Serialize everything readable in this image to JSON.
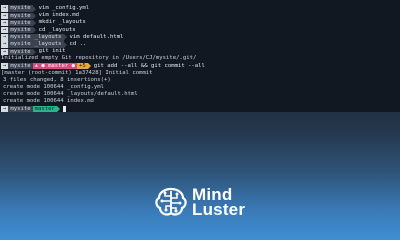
{
  "terminal": {
    "lines": [
      {
        "kind": "prompt",
        "user": "→",
        "dir": "mysite",
        "cmd": "vim _config.yml"
      },
      {
        "kind": "prompt",
        "user": "→",
        "dir": "mysite",
        "cmd": "vim index.md"
      },
      {
        "kind": "prompt",
        "user": "→",
        "dir": "mysite",
        "cmd": "mkdir _layouts"
      },
      {
        "kind": "prompt",
        "user": "→",
        "dir": "mysite",
        "cmd": "cd _layouts"
      },
      {
        "kind": "prompt",
        "user": "→",
        "dir": "mysite",
        "dir2": "_layouts",
        "cmd": "vim default.html"
      },
      {
        "kind": "prompt",
        "user": "→",
        "dir": "mysite",
        "dir2": "_layouts",
        "cmd": "cd .."
      },
      {
        "kind": "prompt",
        "user": "→",
        "dir": "mysite",
        "cmd": "git init"
      },
      {
        "kind": "output",
        "text": "Initialized empty Git repository in /Users/CJ/mysite/.git/"
      },
      {
        "kind": "prompt-git",
        "user": "→",
        "dir": "mysite",
        "branch": "±  ● master ●",
        "count": "+5",
        "cmd": "git add --all && git commit --all"
      },
      {
        "kind": "output",
        "text": "[master (root-commit) 1a37428] Initial commit"
      },
      {
        "kind": "output",
        "text": " 3 files changed, 8 insertions(+)"
      },
      {
        "kind": "output",
        "text": " create mode 100644 _config.yml"
      },
      {
        "kind": "output",
        "text": " create mode 100644 _layouts/default.html"
      },
      {
        "kind": "output",
        "text": " create mode 100644 index.md"
      },
      {
        "kind": "prompt-clean",
        "user": "→",
        "dir": "mysite",
        "branch": "master",
        "cmd": ""
      }
    ]
  },
  "logo": {
    "line1": "Mind",
    "line2": "Luster",
    "icon": "brain-circuit-icon"
  },
  "colors": {
    "terminal_bg": "#111821",
    "branch_clean": "#2bb38a",
    "branch_dirty": "#d84a7c",
    "count_badge": "#e6a93f",
    "gradient_bottom": "#3f8fd0"
  }
}
